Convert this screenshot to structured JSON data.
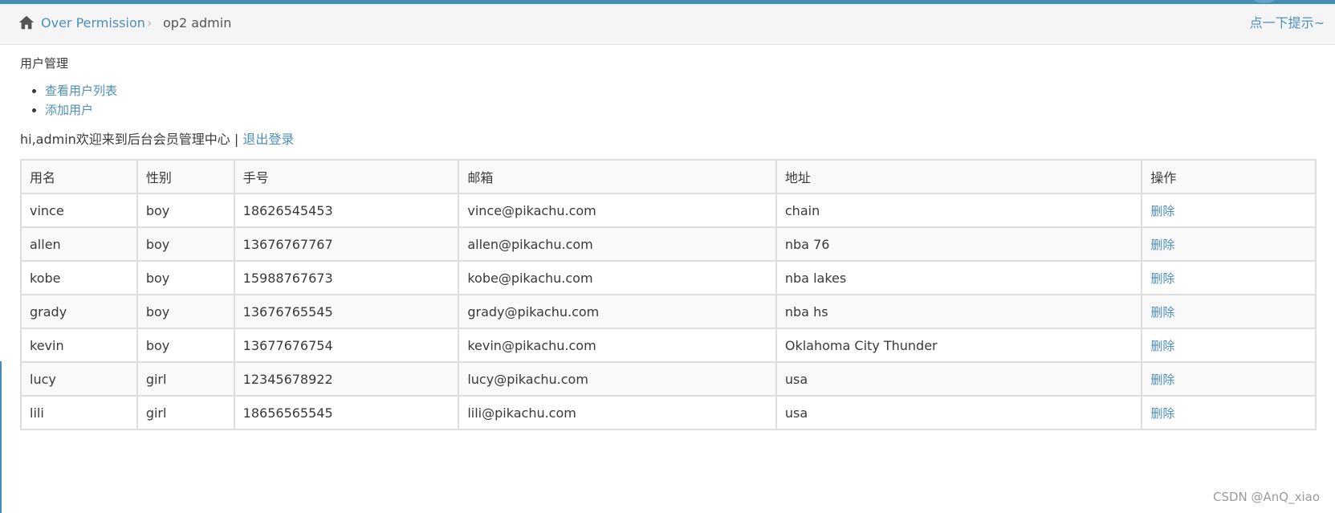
{
  "breadcrumb": {
    "home_icon": "home-icon",
    "parent_label": "Over Permission",
    "separator": "›",
    "current_label": "op2 admin",
    "hint_label": "点一下提示~"
  },
  "section": {
    "title": "用户管理",
    "links": [
      {
        "label": "查看用户列表"
      },
      {
        "label": "添加用户"
      }
    ]
  },
  "welcome": {
    "text": "hi,admin欢迎来到后台会员管理中心",
    "separator": " | ",
    "logout_label": "退出登录"
  },
  "table": {
    "headers": [
      "用名",
      "性别",
      "手号",
      "邮箱",
      "地址",
      "操作"
    ],
    "rows": [
      {
        "name": "vince",
        "sex": "boy",
        "phone": "18626545453",
        "email": "vince@pikachu.com",
        "address": "chain",
        "action": "删除"
      },
      {
        "name": "allen",
        "sex": "boy",
        "phone": "13676767767",
        "email": "allen@pikachu.com",
        "address": "nba 76",
        "action": "删除"
      },
      {
        "name": "kobe",
        "sex": "boy",
        "phone": "15988767673",
        "email": "kobe@pikachu.com",
        "address": "nba lakes",
        "action": "删除"
      },
      {
        "name": "grady",
        "sex": "boy",
        "phone": "13676765545",
        "email": "grady@pikachu.com",
        "address": "nba hs",
        "action": "删除"
      },
      {
        "name": "kevin",
        "sex": "boy",
        "phone": "13677676754",
        "email": "kevin@pikachu.com",
        "address": "Oklahoma City Thunder",
        "action": "删除"
      },
      {
        "name": "lucy",
        "sex": "girl",
        "phone": "12345678922",
        "email": "lucy@pikachu.com",
        "address": "usa",
        "action": "删除"
      },
      {
        "name": "lili",
        "sex": "girl",
        "phone": "18656565545",
        "email": "lili@pikachu.com",
        "address": "usa",
        "action": "删除"
      }
    ]
  },
  "watermark": "CSDN @AnQ_xiao",
  "colors": {
    "accent": "#438eb9",
    "link": "#4c8fbd"
  }
}
